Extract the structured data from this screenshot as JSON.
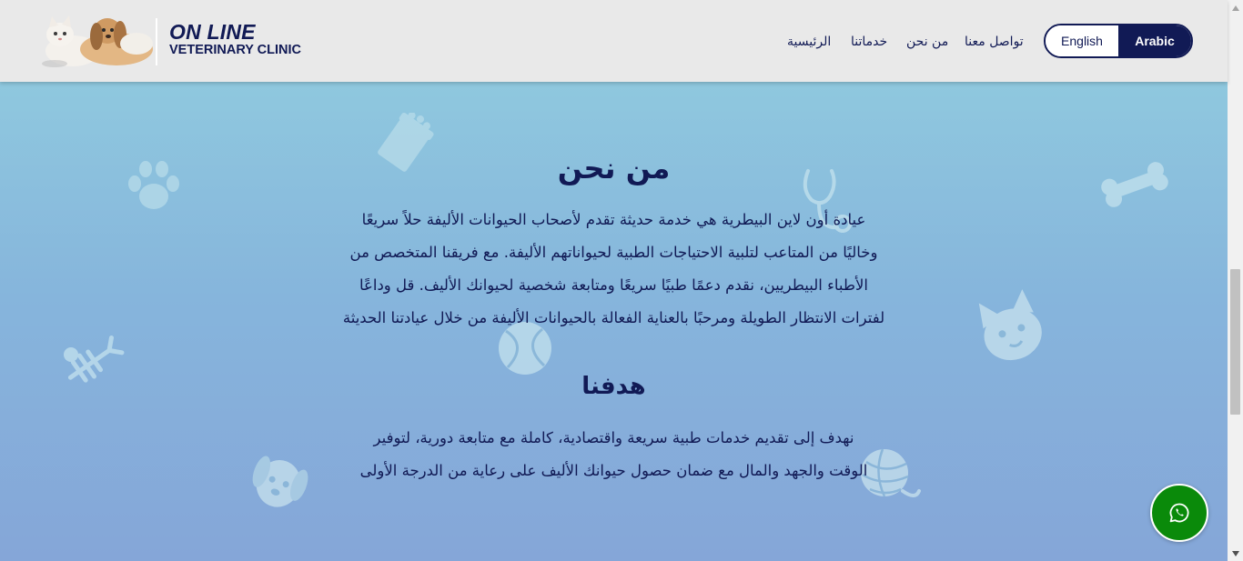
{
  "header": {
    "brand_title": "ON LINE",
    "brand_subtitle": "VETERINARY CLINIC",
    "nav": {
      "home": "الرئيسية",
      "services": "خدماتنا",
      "about": "من نحن",
      "contact": "تواصل معنا"
    },
    "language": {
      "english": "English",
      "arabic": "Arabic",
      "active": "Arabic"
    }
  },
  "about": {
    "title": "من نحن",
    "lines": [
      "عيادة أون لاين البيطرية هي خدمة حديثة تقدم لأصحاب الحيوانات الأليفة حلاً سريعًا",
      "وخاليًا من المتاعب لتلبية الاحتياجات الطبية لحيواناتهم الأليفة. مع فريقنا المتخصص من",
      "الأطباء البيطريين، نقدم دعمًا طبيًا سريعًا ومتابعة شخصية لحيوانك الأليف. قل وداعًا",
      "لفترات الانتظار الطويلة ومرحبًا بالعناية الفعالة بالحيوانات الأليفة من خلال عيادتنا الحديثة"
    ]
  },
  "goal": {
    "title": "هدفنا",
    "lines": [
      "نهدف إلى تقديم خدمات طبية سريعة واقتصادية، كاملة مع متابعة دورية، لتوفير",
      "الوقت والجهد والمال مع ضمان حصول حيوانك الأليف على رعاية من الدرجة الأولى"
    ]
  },
  "decorations": [
    "pet-food-icon",
    "paw-icon",
    "stethoscope-icon",
    "bone-icon",
    "fish-bone-icon",
    "ball-icon",
    "cat-face-icon",
    "dog-face-icon",
    "yarn-icon"
  ],
  "floating": {
    "whatsapp_icon": "whatsapp-icon"
  },
  "colors": {
    "navy": "#111a55",
    "header_bg": "#e9e9e9",
    "whatsapp_green": "#0a8a0a",
    "gradient_top": "#8fc8de",
    "gradient_bottom": "#85a6d8"
  }
}
